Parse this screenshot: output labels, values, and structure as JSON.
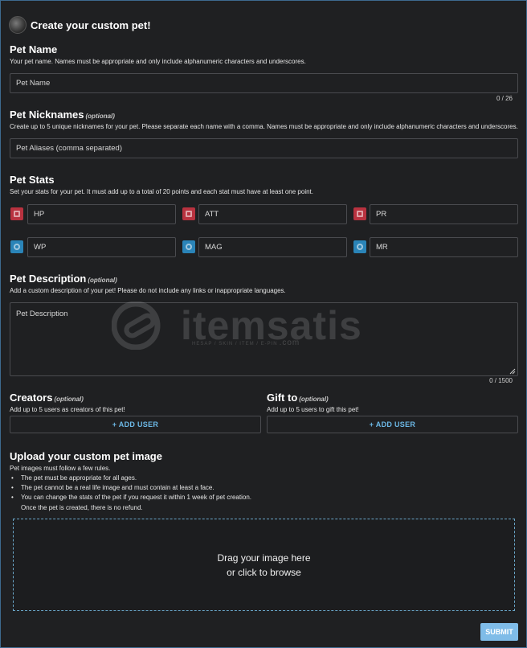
{
  "header": {
    "title": "Create your custom pet!"
  },
  "pet_name": {
    "title": "Pet Name",
    "description": "Your pet name. Names must be appropriate and only include alphanumeric characters and underscores.",
    "placeholder": "Pet Name",
    "counter": "0 / 26"
  },
  "pet_nicknames": {
    "title": "Pet Nicknames",
    "optional": "(optional)",
    "description": "Create up to 5 unique nicknames for your pet. Please separate each name with a comma. Names must be appropriate and only include alphanumeric characters and underscores.",
    "placeholder": "Pet Aliases (comma separated)"
  },
  "pet_stats": {
    "title": "Pet Stats",
    "description": "Set your stats for your pet. It must add up to a total of 20 points and each stat must have at least one point.",
    "stats": [
      {
        "label": "HP",
        "color": "#b8323f",
        "icon": "hp-icon"
      },
      {
        "label": "ATT",
        "color": "#b8323f",
        "icon": "attack-icon"
      },
      {
        "label": "PR",
        "color": "#b8323f",
        "icon": "protection-icon"
      },
      {
        "label": "WP",
        "color": "#2a84b8",
        "icon": "weapon-power-icon"
      },
      {
        "label": "MAG",
        "color": "#2a84b8",
        "icon": "magic-icon"
      },
      {
        "label": "MR",
        "color": "#2a84b8",
        "icon": "magic-resist-icon"
      }
    ]
  },
  "pet_description": {
    "title": "Pet Description",
    "optional": "(optional)",
    "description": "Add a custom description of your pet! Please do not include any links or inappropriate languages.",
    "placeholder": "Pet Description",
    "counter": "0 / 1500"
  },
  "creators": {
    "title": "Creators",
    "optional": "(optional)",
    "description": "Add up to 5 users as creators of this pet!",
    "button": "+ ADD USER"
  },
  "gift_to": {
    "title": "Gift to",
    "optional": "(optional)",
    "description": "Add up to 5 users to gift this pet!",
    "button": "+ ADD USER"
  },
  "upload": {
    "title": "Upload your custom pet image",
    "description": "Pet images must follow a few rules.",
    "rules": [
      "The pet must be appropriate for all ages.",
      "The pet cannot be a real life image and must contain at least a face.",
      "You can change the stats of the pet if you request it within 1 week of pet creation.",
      "Once the pet is created, there is no refund."
    ],
    "drop_line1": "Drag your image here",
    "drop_line2": "or click to browse"
  },
  "submit": "SUBMIT",
  "watermark": {
    "text": "itemsatis",
    "sub": "HESAP / SKIN / ITEM / E-PIN",
    "domain": ".com"
  },
  "colors": {
    "accent": "#7fbce8",
    "link": "#6cb8e6",
    "red_stat": "#b8323f",
    "blue_stat": "#2a84b8",
    "background": "#1f2022"
  }
}
